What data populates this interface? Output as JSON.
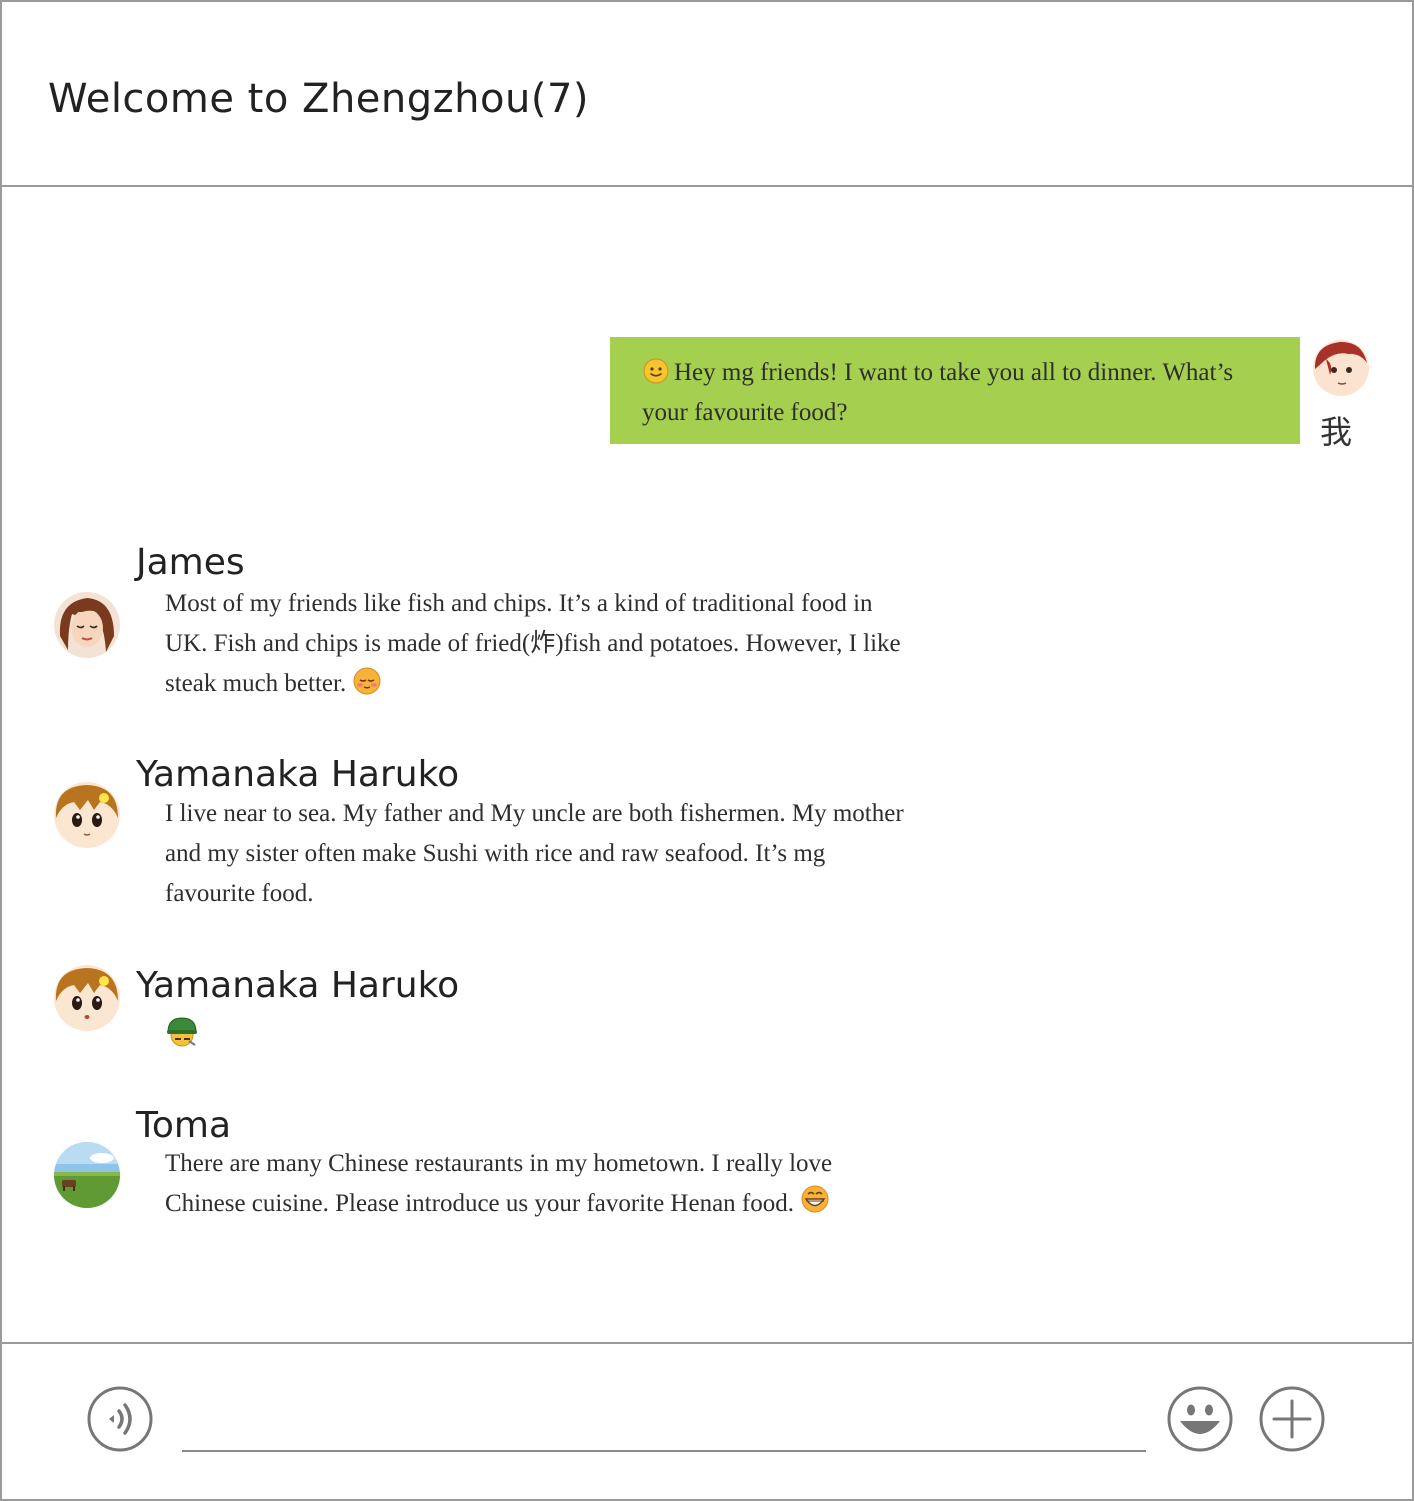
{
  "header": {
    "title": "Welcome to Zhengzhou(7)"
  },
  "my_message": {
    "text": "Hey mg friends! I want to take you all to dinner. What’s your favourite food?",
    "sender": "我"
  },
  "messages": [
    {
      "sender": "James",
      "text": "Most of my friends like fish and chips. It’s a kind of traditional food in UK. Fish and chips is made of fried(炸)fish and potatoes. However, I like steak much better.",
      "emoji": "relieved-emoji-icon"
    },
    {
      "sender": "Yamanaka Haruko",
      "text": "I live near to sea. My father and My uncle are both fishermen. My mother and my sister often make Sushi with rice and raw seafood. It’s mg favourite food."
    },
    {
      "sender": "Yamanaka Haruko",
      "text": "",
      "emoji": "army-helmet-emoji-icon"
    },
    {
      "sender": "Toma",
      "text": "There are many Chinese restaurants in my hometown. I really love Chinese cuisine. Please introduce us your  favorite Henan food.",
      "emoji": "grin-emoji-icon"
    }
  ],
  "input": {
    "value": "",
    "placeholder": ""
  },
  "colors": {
    "my_bubble": "#a5cf4f",
    "border": "#9a9a9a",
    "icon_stroke": "#777777"
  },
  "icons": [
    "voice-icon",
    "emoji-icon",
    "plus-icon"
  ]
}
